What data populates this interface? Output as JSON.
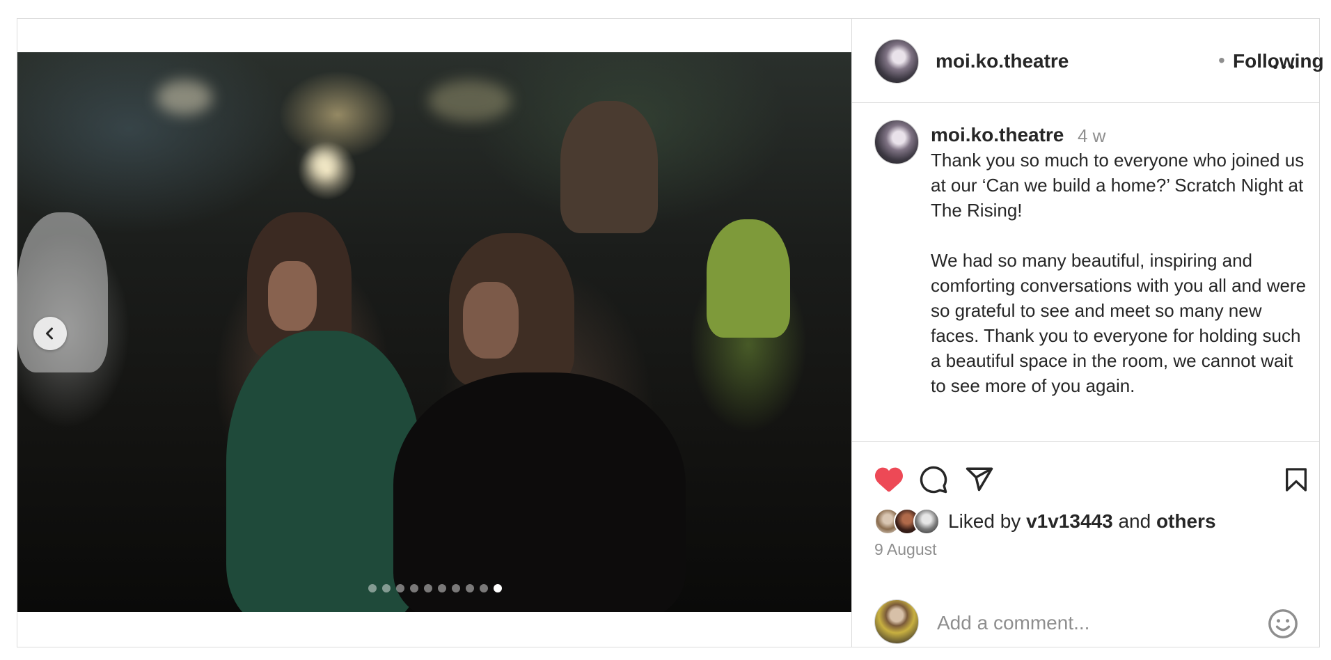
{
  "post": {
    "carousel": {
      "total_slides": 10,
      "active_index": 9,
      "prev_icon": "chevron-left-icon"
    }
  },
  "header": {
    "username": "moi.ko.theatre",
    "separator": "•",
    "follow_status": "Following",
    "more_icon": "more-horizontal-icon"
  },
  "caption": {
    "username": "moi.ko.theatre",
    "time": "4 w",
    "text": "Thank you so much to everyone who joined us at our ‘Can we build a home?’ Scratch Night at The Rising!\n\nWe had so many beautiful, inspiring and comforting conversations with you all and were so grateful to see and meet so many new faces. Thank you to everyone for holding such a beautiful space in the room, we cannot wait to see more of you again."
  },
  "actions": {
    "like_icon": "heart-filled-icon",
    "comment_icon": "comment-icon",
    "share_icon": "paper-plane-icon",
    "save_icon": "bookmark-icon",
    "liked_color": "#ed4956"
  },
  "likes": {
    "prefix": "Liked by",
    "user": "v1v13443",
    "conjunction": "and",
    "others": "others"
  },
  "date": "9 August",
  "comment": {
    "placeholder": "Add a comment...",
    "emoji_icon": "smiley-icon"
  }
}
